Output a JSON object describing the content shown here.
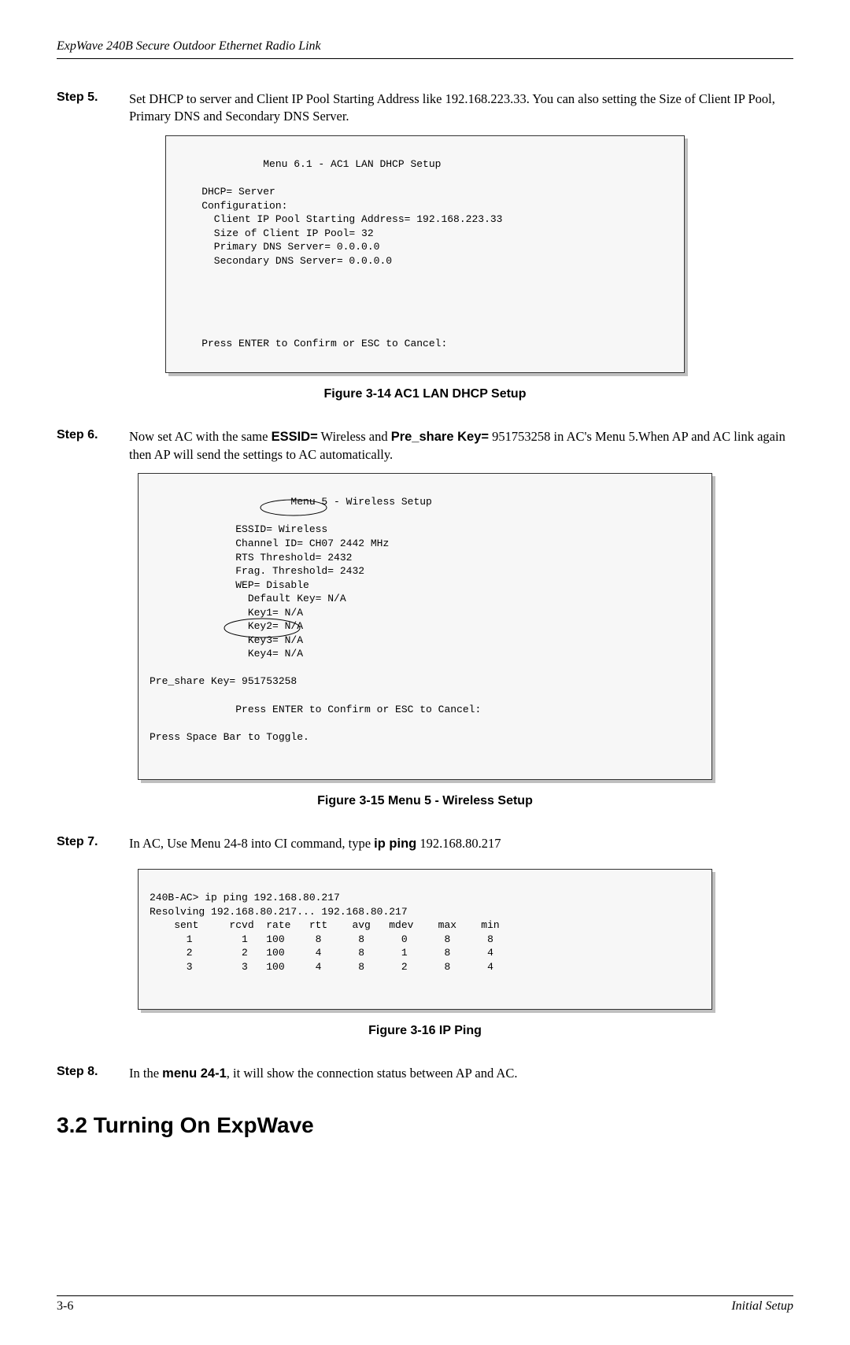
{
  "header": {
    "title": "ExpWave 240B Secure Outdoor Ethernet Radio Link"
  },
  "step5": {
    "label": "Step 5.",
    "text_a": "Set DHCP to server and Client IP Pool Starting Address like 192.168.223.33. You can also setting the Size of Client IP Pool, Primary DNS and Secondary DNS Server."
  },
  "term1": {
    "l1": "              Menu 6.1 - AC1 LAN DHCP Setup",
    "l2": "",
    "l3": "    DHCP= Server",
    "l4": "    Configuration:",
    "l5": "      Client IP Pool Starting Address= 192.168.223.33",
    "l6": "      Size of Client IP Pool= 32",
    "l7": "      Primary DNS Server= 0.0.0.0",
    "l8": "      Secondary DNS Server= 0.0.0.0",
    "l9": "",
    "l10": "",
    "l11": "",
    "l12": "",
    "l13": "",
    "l14": "    Press ENTER to Confirm or ESC to Cancel:"
  },
  "fig1": {
    "caption": "Figure 3-14 AC1 LAN DHCP Setup"
  },
  "step6": {
    "label": "Step 6.",
    "t1": "Now set AC with the same ",
    "b1": "ESSID=",
    "t2": " Wireless and ",
    "b2": "Pre_share Key=",
    "t3": " 951753258 in AC's Menu 5.When AP and AC link again then AP will send the settings to AC automatically."
  },
  "term2": {
    "l1": "                       Menu 5 - Wireless Setup",
    "l2": "",
    "l3": "              ESSID= Wireless",
    "l4": "              Channel ID= CH07 2442 MHz",
    "l5": "              RTS Threshold= 2432",
    "l6": "              Frag. Threshold= 2432",
    "l7": "              WEP= Disable",
    "l8": "                Default Key= N/A",
    "l9": "                Key1= N/A",
    "l10": "                Key2= N/A",
    "l11": "                Key3= N/A",
    "l12": "                Key4= N/A",
    "l13": "",
    "l14": "Pre_share Key= 951753258",
    "l15": "",
    "l16": "              Press ENTER to Confirm or ESC to Cancel:",
    "l17": "",
    "l18": "Press Space Bar to Toggle."
  },
  "fig2": {
    "caption": "Figure 3-15 Menu 5 - Wireless Setup"
  },
  "step7": {
    "label": "Step 7.",
    "t1": "In AC, Use Menu 24-8 into CI command, type ",
    "b1": "ip ping",
    "t2": " 192.168.80.217"
  },
  "term3": {
    "l1": "240B-AC> ip ping 192.168.80.217",
    "l2": "Resolving 192.168.80.217... 192.168.80.217",
    "l3": "    sent     rcvd  rate   rtt    avg   mdev    max    min",
    "l4": "      1        1   100     8      8      0      8      8",
    "l5": "      2        2   100     4      8      1      8      4",
    "l6": "      3        3   100     4      8      2      8      4",
    "l7": ""
  },
  "fig3": {
    "caption": "Figure 3-16 IP Ping"
  },
  "step8": {
    "label": "Step 8.",
    "t1": "In the ",
    "b1": "menu 24-1",
    "t2": ", it will show the connection status between AP and AC."
  },
  "section": {
    "title": "3.2  Turning On ExpWave"
  },
  "footer": {
    "page": "3-6",
    "section": "Initial Setup"
  }
}
